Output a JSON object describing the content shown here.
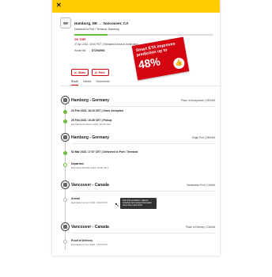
{
  "window": {
    "close_label": "✕"
  },
  "shipment": {
    "route": "Hamburg, DE → Vancouver, CA",
    "subtitle": "Delivered to Port / Terminal, Hamburg",
    "progress_percent": 24,
    "status": "ON TIME",
    "eta": "27 Apr 2022, 15:00 PST | Estimated Arrival at Destination",
    "house_bill_label": "House bill:",
    "house_bill_value": "DTZ943951"
  },
  "actions": {
    "share_label": "Share",
    "print_label": "Print"
  },
  "promo": {
    "line1": "Smart ETA improves",
    "line2": "prediction up to",
    "big": "48%"
  },
  "tabs": [
    {
      "label": "Route",
      "active": true
    },
    {
      "label": "Details",
      "active": false
    },
    {
      "label": "Documents",
      "active": false
    }
  ],
  "stops": [
    {
      "name": "Hamburg - Germany",
      "role": "Place of Acceptance | DEHAM",
      "events": [
        {
          "title": "24 Feb 2022, 16:19 CET | Order Accepted",
          "sub": "",
          "state": "done"
        },
        {
          "title": "25 Feb 2022, 10:26 CET | Pickup",
          "sub": "Estimated 02 March 2022, 16:00 CET",
          "state": "done"
        }
      ]
    },
    {
      "name": "Hamburg - Germany",
      "role": "Origin Port | DEHAM",
      "events": [
        {
          "title": "02 Mar 2022, 17:07 CET | Delivered to Port / Terminal",
          "sub": "",
          "state": "done"
        },
        {
          "title": "Departure",
          "sub": "Estimated 05 Mar 2022, 20:00 CET",
          "state": "pending"
        }
      ]
    },
    {
      "name": "Vancouver - Canada",
      "role": "Destination Port | CAVAN",
      "events": [
        {
          "title": "Arrival",
          "sub": "Estimated 12 Apr 2022, 18:00 PST",
          "state": "pending"
        }
      ]
    },
    {
      "name": "Vancouver - Canada",
      "role": "Place of Delivery | CAVAN",
      "events": [
        {
          "title": "Proof of Delivery",
          "sub": "Estimated 27 Apr 2022, 15:00 PST",
          "state": "pending"
        }
      ]
    }
  ],
  "tooltip": "DHL ETA prediction, reflects schedule and vessel information more than ocean ETA"
}
